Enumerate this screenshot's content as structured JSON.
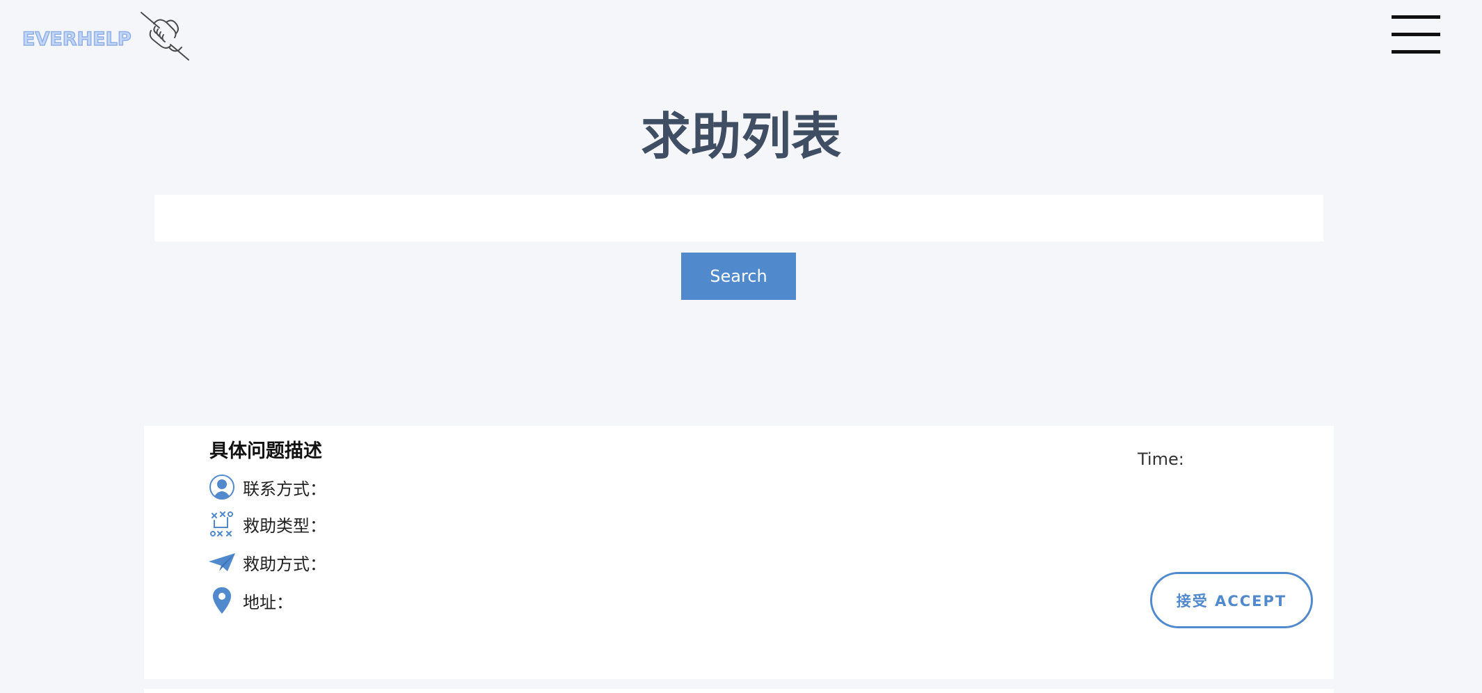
{
  "header": {
    "logo_text": "EVERHELP",
    "logo_icon": "handshake-icon",
    "menu_icon": "hamburger-menu-icon"
  },
  "main": {
    "title": "求助列表",
    "search": {
      "placeholder": "",
      "value": "",
      "button_label": "Search"
    }
  },
  "card": {
    "title": "具体问题描述",
    "time_label": "Time:",
    "fields": [
      {
        "icon": "person-icon",
        "label": "联系方式："
      },
      {
        "icon": "strategy-icon",
        "label": "救助类型："
      },
      {
        "icon": "paper-plane-icon",
        "label": "救助方式："
      },
      {
        "icon": "location-pin-icon",
        "label": "地址："
      }
    ],
    "accept_label": "接受 ACCEPT"
  },
  "colors": {
    "background": "#f5f6fa",
    "accent": "#5089cc",
    "title": "#3f4e63",
    "logo": "#c3d6f5"
  }
}
